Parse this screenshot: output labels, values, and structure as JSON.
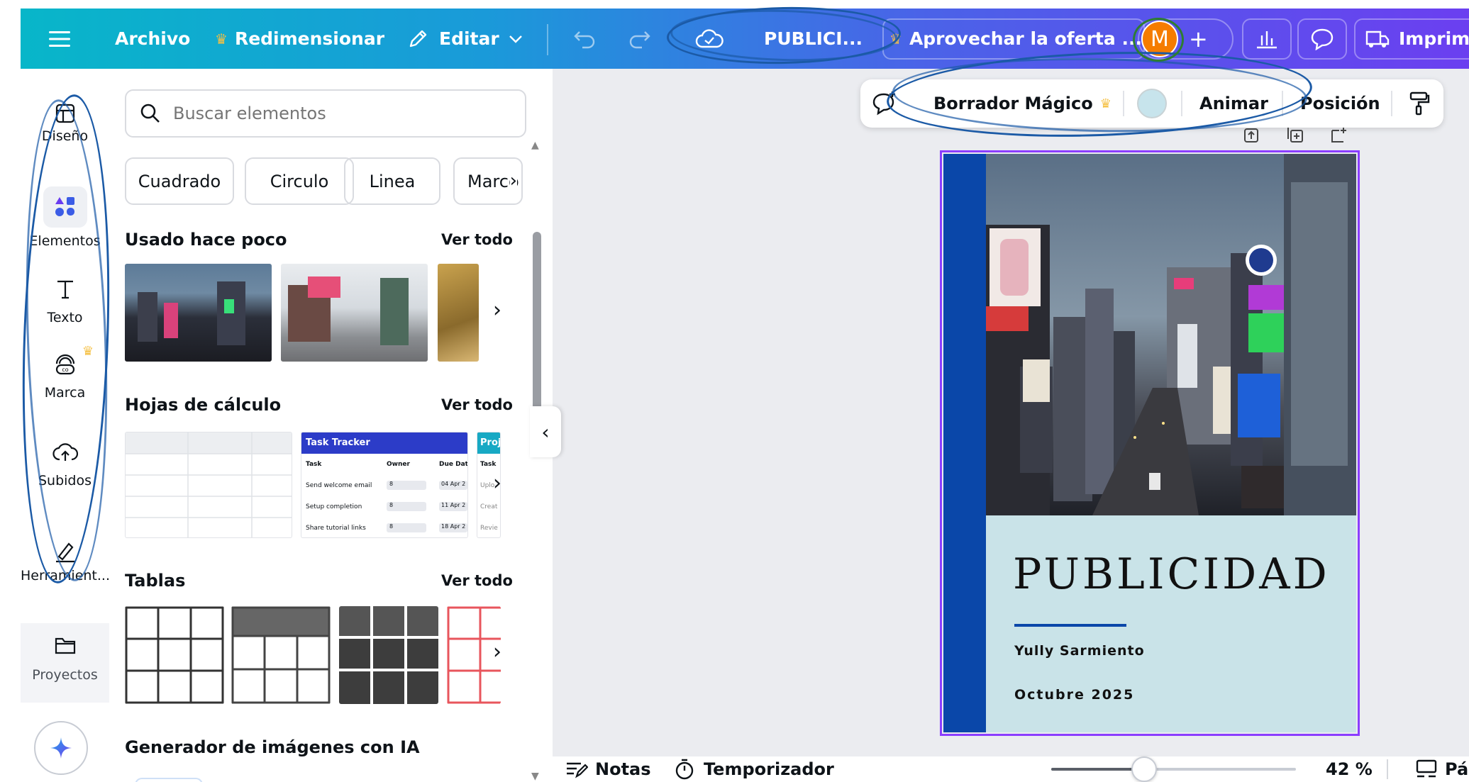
{
  "topbar": {
    "menu_icon": "hamburger-menu-icon",
    "file_label": "Archivo",
    "resize_label": "Redimensionar",
    "edit_label": "Editar",
    "design_title": "PUBLICI...",
    "offer_label": "Aprovechar la oferta ...",
    "avatar_initial": "M",
    "add_label": "+",
    "print_label": "Imprimi"
  },
  "rail": {
    "items": [
      {
        "label": "Diseño",
        "icon": "layout-icon"
      },
      {
        "label": "Elementos",
        "icon": "shapes-icon"
      },
      {
        "label": "Texto",
        "icon": "text-icon"
      },
      {
        "label": "Marca",
        "icon": "brand-icon"
      },
      {
        "label": "Subidos",
        "icon": "cloud-upload-icon"
      },
      {
        "label": "Herramient...",
        "icon": "draw-tools-icon"
      },
      {
        "label": "Proyectos",
        "icon": "folder-icon"
      }
    ],
    "magic_icon": "sparkle-icon"
  },
  "panel": {
    "search_placeholder": "Buscar elementos",
    "chips": [
      "Cuadrado",
      "Circulo",
      "Linea",
      "Marco"
    ],
    "recent": {
      "title": "Usado hace poco",
      "link": "Ver todo"
    },
    "sheets": {
      "title": "Hojas de cálculo",
      "link": "Ver todo"
    },
    "tables": {
      "title": "Tablas",
      "link": "Ver todo"
    },
    "ai": {
      "title": "Generador de imágenes con IA"
    },
    "task_tracker": {
      "title": "Task Tracker",
      "second_title": "Proj",
      "headers": [
        "Task",
        "Owner",
        "Due Date"
      ],
      "rows": [
        [
          "Send welcome email",
          "8",
          "04 Apr 2"
        ],
        [
          "Setup completion",
          "8",
          "11 Apr 2"
        ],
        [
          "Share tutorial links",
          "8",
          "18 Apr 2"
        ]
      ],
      "side_col_header": "Task",
      "side_col": [
        "Uplo",
        "Creat",
        "Revie"
      ]
    }
  },
  "toolbar": {
    "magic_eraser_label": "Borrador Mágico",
    "animate_label": "Animar",
    "position_label": "Posición",
    "color_swatch": "#c7e4ec"
  },
  "page": {
    "title": "PUBLICIDAD",
    "author": "Yully Sarmiento",
    "date": "Octubre 2025",
    "accent": "#0a47a9",
    "bg": "#c9e3e8"
  },
  "bottombar": {
    "notes_label": "Notas",
    "timer_label": "Temporizador",
    "zoom": "42 %",
    "zoom_fraction": 0.38,
    "pages_label": "Pá"
  },
  "colors": {
    "accent": "#8b3dff",
    "avatar": "#f57c00",
    "annotation": "#1b5aa6"
  }
}
